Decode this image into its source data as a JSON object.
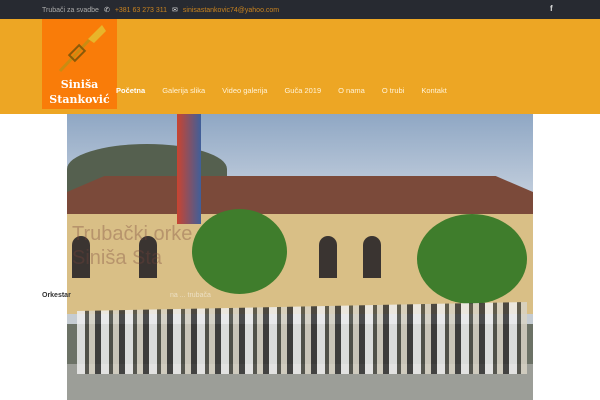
{
  "topbar": {
    "tagline": "Trubači za svadbe",
    "phone": "+381 63 273 311",
    "email": "sinisastankovic74@yahoo.com",
    "social": "f"
  },
  "logo": {
    "line1": "Siniša",
    "line2": "Stanković"
  },
  "nav": [
    "Početna",
    "Galerija slika",
    "Video galerija",
    "Guča 2019",
    "O nama",
    "O trubi",
    "Kontakt"
  ],
  "hero": {
    "overlay1": "Trubački orke",
    "overlay2": "Siniša Sta",
    "caption": "Orkestar",
    "caption_rest": "na ... trubača"
  }
}
